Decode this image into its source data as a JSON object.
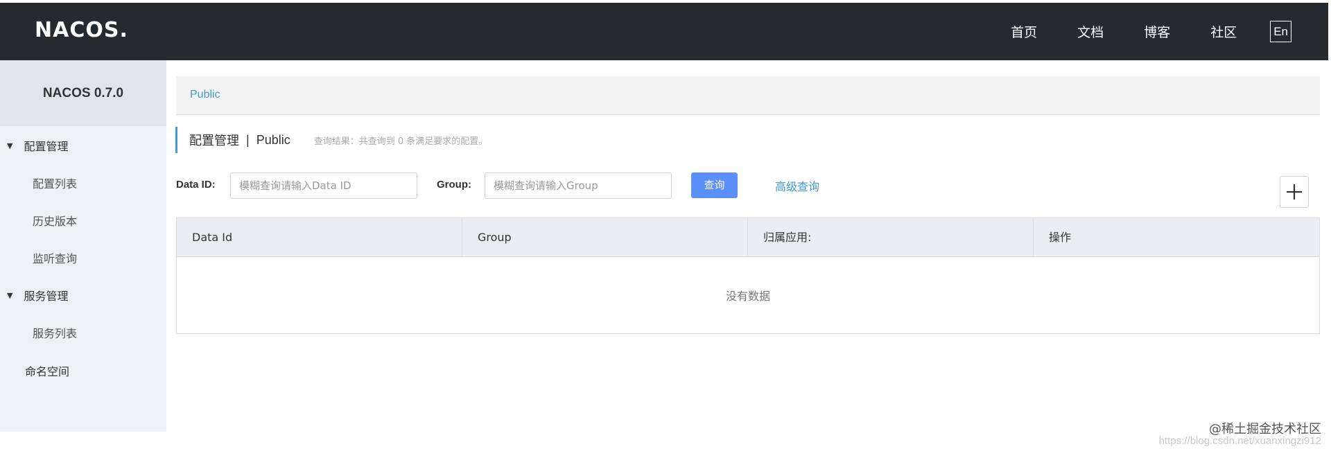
{
  "header": {
    "logo": "NACOS.",
    "nav": [
      "首页",
      "文档",
      "博客",
      "社区"
    ],
    "lang": "En"
  },
  "sidebar": {
    "version": "NACOS 0.7.0",
    "groups": [
      {
        "label": "配置管理",
        "items": [
          "配置列表",
          "历史版本",
          "监听查询"
        ]
      },
      {
        "label": "服务管理",
        "items": [
          "服务列表"
        ]
      }
    ],
    "namespace": "命名空间"
  },
  "breadcrumb": "Public",
  "page": {
    "title": "配置管理",
    "separator": "|",
    "namespace": "Public",
    "result": "查询结果：共查询到 0 条满足要求的配置。"
  },
  "search": {
    "data_id_label": "Data ID:",
    "data_id_placeholder": "模糊查询请输入Data ID",
    "group_label": "Group:",
    "group_placeholder": "模糊查询请输入Group",
    "query_button": "查询",
    "advanced_link": "高级查询"
  },
  "table": {
    "columns": [
      "Data Id",
      "Group",
      "归属应用:",
      "操作"
    ],
    "empty_text": "没有数据"
  },
  "watermark": {
    "text": "@稀土掘金技术社区",
    "url": "https://blog.csdn.net/xuanxingzi912"
  },
  "colors": {
    "topbar": "#252a2f",
    "sidebar": "#eef0f3",
    "accent": "#3f9ad6",
    "primary_button": "#5b8ff9"
  }
}
